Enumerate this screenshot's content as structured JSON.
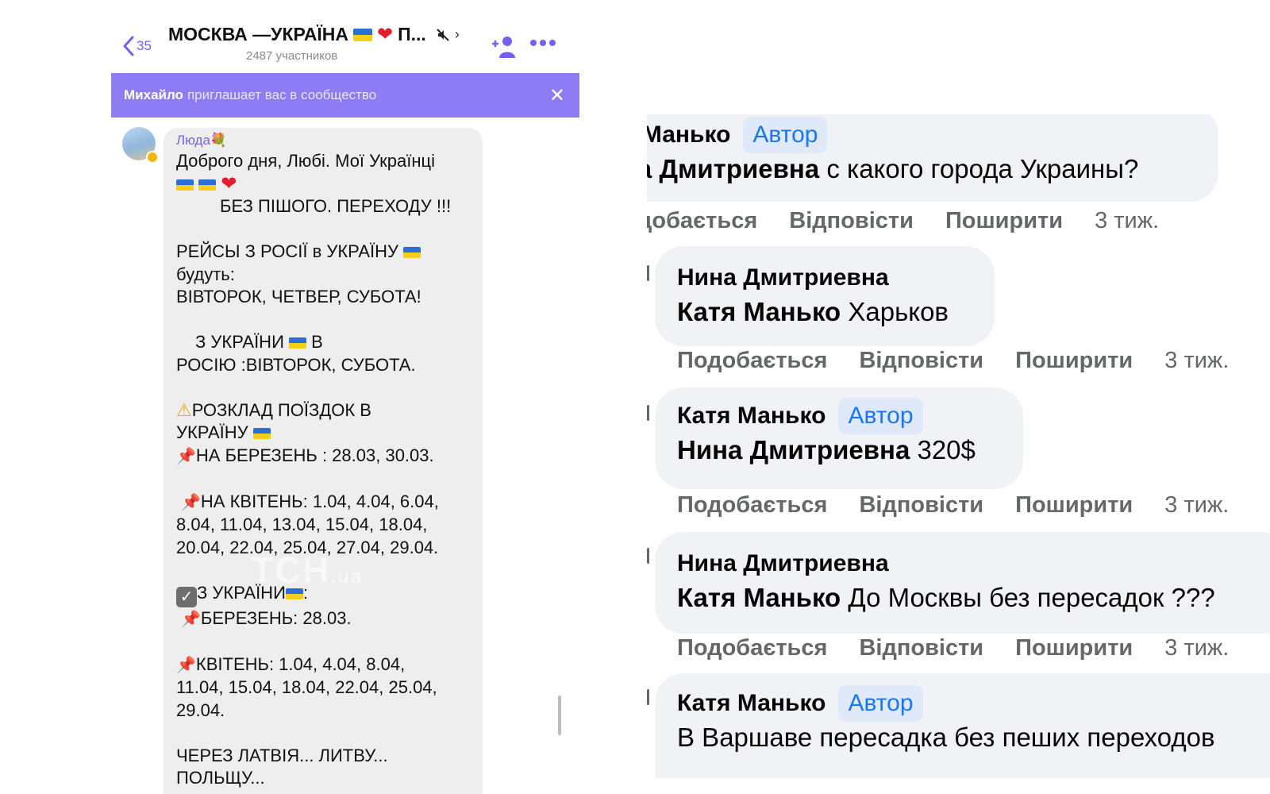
{
  "chat": {
    "back_count": "35",
    "title": "МОСКВА —УКРАЇНА",
    "title_suffix": "П...",
    "participants": "2487 участников",
    "banner": {
      "inviter": "Михайло",
      "text": "приглашает вас в сообщество"
    },
    "message": {
      "sender": "Люда",
      "lines": {
        "l1": "Доброго дня, Любі. Мої Українці",
        "l3": "БЕЗ  ПІШОГО. ПЕРЕХОДУ !!!",
        "l5": "РЕЙСЫ З РОСІЇ в УКРАЇНУ",
        "l6": "будуть:",
        "l7": "ВІВТОРОК, ЧЕТВЕР, СУБОТА!",
        "l9": "З УКРАЇНИ",
        "l9b": "В",
        "l10": "РОСІЮ :ВІВТОРОК, СУБОТА.",
        "l12": "РОЗКЛАД ПОЇЗДОК В",
        "l13": "УКРАЇНУ",
        "l14": "НА БЕРЕЗЕНЬ : 28.03, 30.03.",
        "l16": "НА КВІТЕНЬ: 1.04, 4.04, 6.04,",
        "l17": "8.04, 11.04, 13.04, 15.04, 18.04,",
        "l18": "20.04, 22.04, 25.04, 27.04, 29.04.",
        "l20": "З УКРАЇНИ",
        "l20b": ":",
        "l21": "БЕРЕЗЕНЬ: 28.03.",
        "l23": "КВІТЕНЬ: 1.04, 4.04, 8.04,",
        "l24": "11.04, 15.04, 18.04, 22.04, 25.04,",
        "l25": "29.04.",
        "l27": "ЧЕРЕЗ  ЛАТВІЯ... ЛИТВУ...",
        "l28": "ПОЛЬЩУ..."
      }
    },
    "watermark": "ТСН",
    "watermark_suffix": ".ua"
  },
  "comments": {
    "author_badge": "Автор",
    "like_label": "Подобається",
    "reply_label": "Відповісти",
    "share_label": "Поширити",
    "time": "3 тиж.",
    "first_like_label": "добається",
    "items": [
      {
        "author": "я Манько",
        "mention": "на Дмитриевна",
        "text": " с какого города Украины?"
      },
      {
        "author": "Нина Дмитриевна",
        "mention": "Катя Манько",
        "text": " Харьков"
      },
      {
        "author": "Катя Манько",
        "mention": "Нина Дмитриевна",
        "text": " 320$"
      },
      {
        "author": "Нина Дмитриевна",
        "mention": "Катя Манько",
        "text": " До Москвы без пересадок ???"
      },
      {
        "author": "Катя Манько",
        "mention": "",
        "text": "В Варшаве пересадка без пеших переходов"
      }
    ]
  }
}
